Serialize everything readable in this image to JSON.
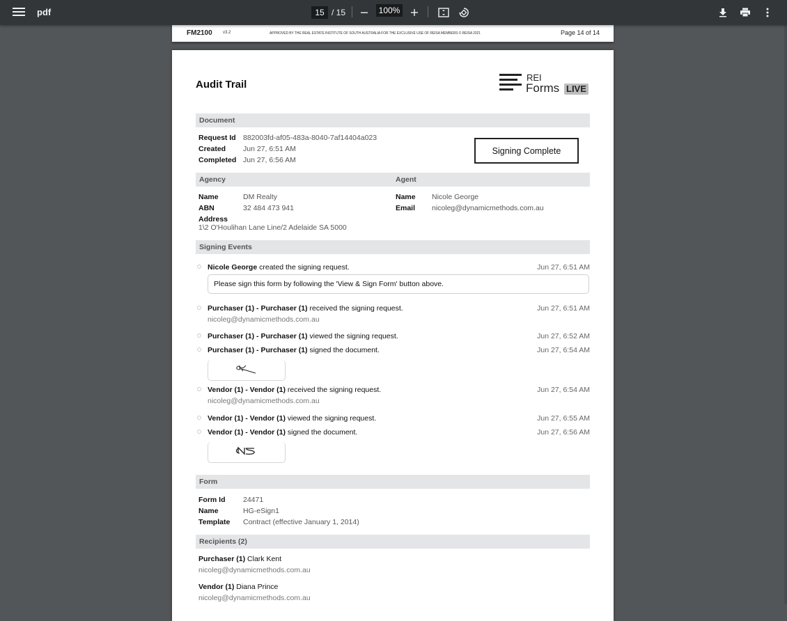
{
  "toolbar": {
    "title": "pdf",
    "current_page": "15",
    "total_pages": "/ 15",
    "zoom": "100%",
    "icons": {
      "menu": "menu-icon",
      "zoom_out": "minus-icon",
      "zoom_in": "plus-icon",
      "fit": "fit-page-icon",
      "rotate": "rotate-icon",
      "download": "download-icon",
      "print": "print-icon",
      "more": "more-vert-icon"
    }
  },
  "prev_page_footer": {
    "form_code": "FM2100",
    "version": "v3.2",
    "approved": "APPROVED BY THE REAL ESTATE INSTITUTE OF SOUTH AUSTRALIA FOR THE EXCLUSIVE USE OF REISA MEMBERS © REISA 2021",
    "page": "Page 14 of 14"
  },
  "doc": {
    "title": "Audit Trail",
    "logo": {
      "rei": "REI",
      "forms": "Forms",
      "live": "LIVE"
    },
    "document": {
      "heading": "Document",
      "request_id_label": "Request Id",
      "request_id": "882003fd-af05-483a-8040-7af14404a023",
      "created_label": "Created",
      "created": "Jun 27, 6:51 AM",
      "completed_label": "Completed",
      "completed": "Jun 27, 6:56 AM",
      "status": "Signing Complete"
    },
    "agency": {
      "heading": "Agency",
      "name_label": "Name",
      "name": "DM Realty",
      "abn_label": "ABN",
      "abn": "32 484 473 941",
      "address_label": "Address",
      "address": "1\\2 O'Houlihan Lane Line/2 Adelaide SA 5000"
    },
    "agent": {
      "heading": "Agent",
      "name_label": "Name",
      "name": "Nicole George",
      "email_label": "Email",
      "email": "nicoleg@dynamicmethods.com.au"
    },
    "signing_events": {
      "heading": "Signing Events",
      "events": [
        {
          "actor": "Nicole George",
          "action": " created the signing request.",
          "time": "Jun 27, 6:51 AM",
          "message": "Please sign this form by following the 'View & Sign Form' button above."
        },
        {
          "actor": "Purchaser (1) - Purchaser (1)",
          "action": " received the signing request.",
          "time": "Jun 27, 6:51 AM",
          "email": "nicoleg@dynamicmethods.com.au"
        },
        {
          "actor": "Purchaser (1) - Purchaser (1)",
          "action": " viewed the signing request.",
          "time": "Jun 27, 6:52 AM"
        },
        {
          "actor": "Purchaser (1) - Purchaser (1)",
          "action": " signed the document.",
          "time": "Jun 27, 6:54 AM"
        },
        {
          "actor": "Vendor (1) - Vendor (1)",
          "action": " received the signing request.",
          "time": "Jun 27, 6:54 AM",
          "email": "nicoleg@dynamicmethods.com.au"
        },
        {
          "actor": "Vendor (1) - Vendor (1)",
          "action": " viewed the signing request.",
          "time": "Jun 27, 6:55 AM"
        },
        {
          "actor": "Vendor (1) - Vendor (1)",
          "action": " signed the document.",
          "time": "Jun 27, 6:56 AM"
        }
      ]
    },
    "form": {
      "heading": "Form",
      "form_id_label": "Form Id",
      "form_id": "24471",
      "name_label": "Name",
      "name": "HG-eSign1",
      "template_label": "Template",
      "template": "Contract (effective January 1, 2014)"
    },
    "recipients": {
      "heading": "Recipients (2)",
      "items": [
        {
          "role": "Purchaser (1)",
          "name": " Clark Kent",
          "email": "nicoleg@dynamicmethods.com.au"
        },
        {
          "role": "Vendor (1)",
          "name": " Diana Prince",
          "email": "nicoleg@dynamicmethods.com.au"
        }
      ]
    }
  }
}
